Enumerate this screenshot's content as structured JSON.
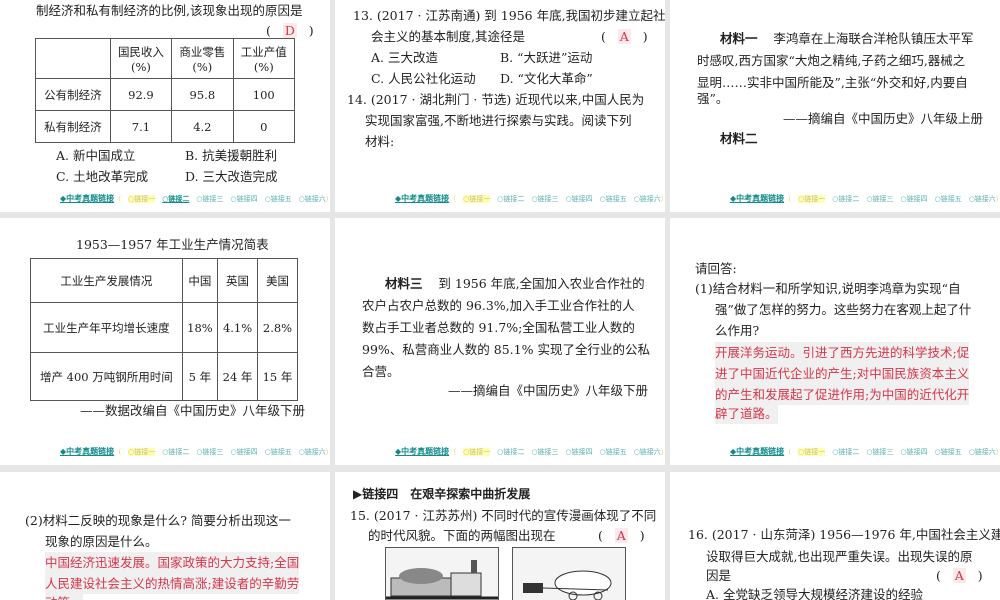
{
  "footer": {
    "main": "◆中考真题链接",
    "open": "（",
    "close": "）",
    "links": [
      "○链接一",
      "○链接二",
      "○链接三",
      "○链接四",
      "○链接五",
      "○链接六"
    ]
  },
  "slide1": {
    "line1": "制经济和私有制经济的比例,该现象出现的原因是",
    "paren_open": "(",
    "answer": "D",
    "paren_close": ")",
    "headers": [
      "国民收入",
      "商业零售",
      "工业产值"
    ],
    "unit": "(%)",
    "rows": [
      {
        "label": "公有制经济",
        "values": [
          "92.9",
          "95.8",
          "100"
        ]
      },
      {
        "label": "私有制经济",
        "values": [
          "7.1",
          "4.2",
          "0"
        ]
      }
    ],
    "options": [
      "A. 新中国成立",
      "B. 抗美援朝胜利",
      "C. 土地改革完成",
      "D. 三大改造完成"
    ]
  },
  "slide2": {
    "q13_l1": "13. (2017 · 江苏南通) 到 1956 年底,我国初步建立起社",
    "q13_l2": "会主义的基本制度,其途径是",
    "answer": "A",
    "options": [
      "A. 三大改造",
      "B. “大跃进”运动",
      "C. 人民公社化运动",
      "D. “文化大革命”"
    ],
    "q14_l1": "14. (2017 · 湖北荆门 · 节选) 近现代以来,中国人民为",
    "q14_l2": "实现国家富强,不断地进行探索与实践。阅读下列",
    "q14_l3": "材料:"
  },
  "slide3": {
    "m1_label": "材料一",
    "m1_l1": "李鸿章在上海联合洋枪队镇压太平军",
    "m1_l2": "时感叹,西方国家“大炮之精纯,子药之细巧,器械之",
    "m1_l3": "显明……实非中国所能及”,主张“外交和好,内要自",
    "m1_l4": "强”。",
    "source": "——摘编自《中国历史》八年级上册",
    "m2_label": "材料二"
  },
  "slide4": {
    "title": "1953—1957 年工业生产情况简表",
    "headers": [
      "工业生产发展情况",
      "中国",
      "英国",
      "美国"
    ],
    "rows": [
      [
        "工业生产年平均增长速度",
        "18%",
        "4.1%",
        "2.8%"
      ],
      [
        "增产 400 万吨钢所用时间",
        "5 年",
        "24 年",
        "15 年"
      ]
    ],
    "source": "——数据改编自《中国历史》八年级下册"
  },
  "slide5": {
    "m3_label": "材料三",
    "l1": "到 1956 年底,全国加入农业合作社的",
    "l2": "农户占农户总数的 96.3%,加入手工业合作社的人",
    "l3": "数占手工业者总数的 91.7%;全国私营工业人数的",
    "l4": "99%、私营商业人数的 85.1% 实现了全行业的公私",
    "l5": "合营。",
    "source": "——摘编自《中国历史》八年级下册"
  },
  "slide6": {
    "prompt": "请回答:",
    "q1_l1": "(1)结合材料一和所学知识,说明李鸿章为实现“自",
    "q1_l2": "强”做了怎样的努力。这些努力在客观上起了什",
    "q1_l3": "么作用?",
    "a_l1": "开展洋务运动。引进了西方先进的科学技术;促",
    "a_l2": "进了中国近代企业的产生;对中国民族资本主义",
    "a_l3": "的产生和发展起了促进作用;为中国的近代化开",
    "a_l4": "辟了道路。"
  },
  "slide7": {
    "q2_l1": "(2)材料二反映的现象是什么? 简要分析出现这一",
    "q2_l2": "现象的原因是什么。",
    "a_l1": "中国经济迅速发展。国家政策的大力支持;全国",
    "a_l2": "人民建设社会主义的热情高涨;建设者的辛勤劳",
    "a_l3": "动等。"
  },
  "slide8": {
    "section": "▶链接四　在艰辛探索中曲折发展",
    "q15_l1": "15. (2017 · 江苏苏州) 不同时代的宣传漫画体现了不同",
    "q15_l2": "的时代风貌。下面的两幅图出现在",
    "answer": "A"
  },
  "slide9": {
    "q16_l1": "16. (2017 · 山东菏泽) 1956—1976 年,中国社会主义建",
    "q16_l2": "设取得巨大成就,也出现严重失误。出现失误的原",
    "q16_l3": "因是",
    "answer": "A",
    "option_a": "A. 全党缺乏领导大规模经济建设的经验"
  }
}
